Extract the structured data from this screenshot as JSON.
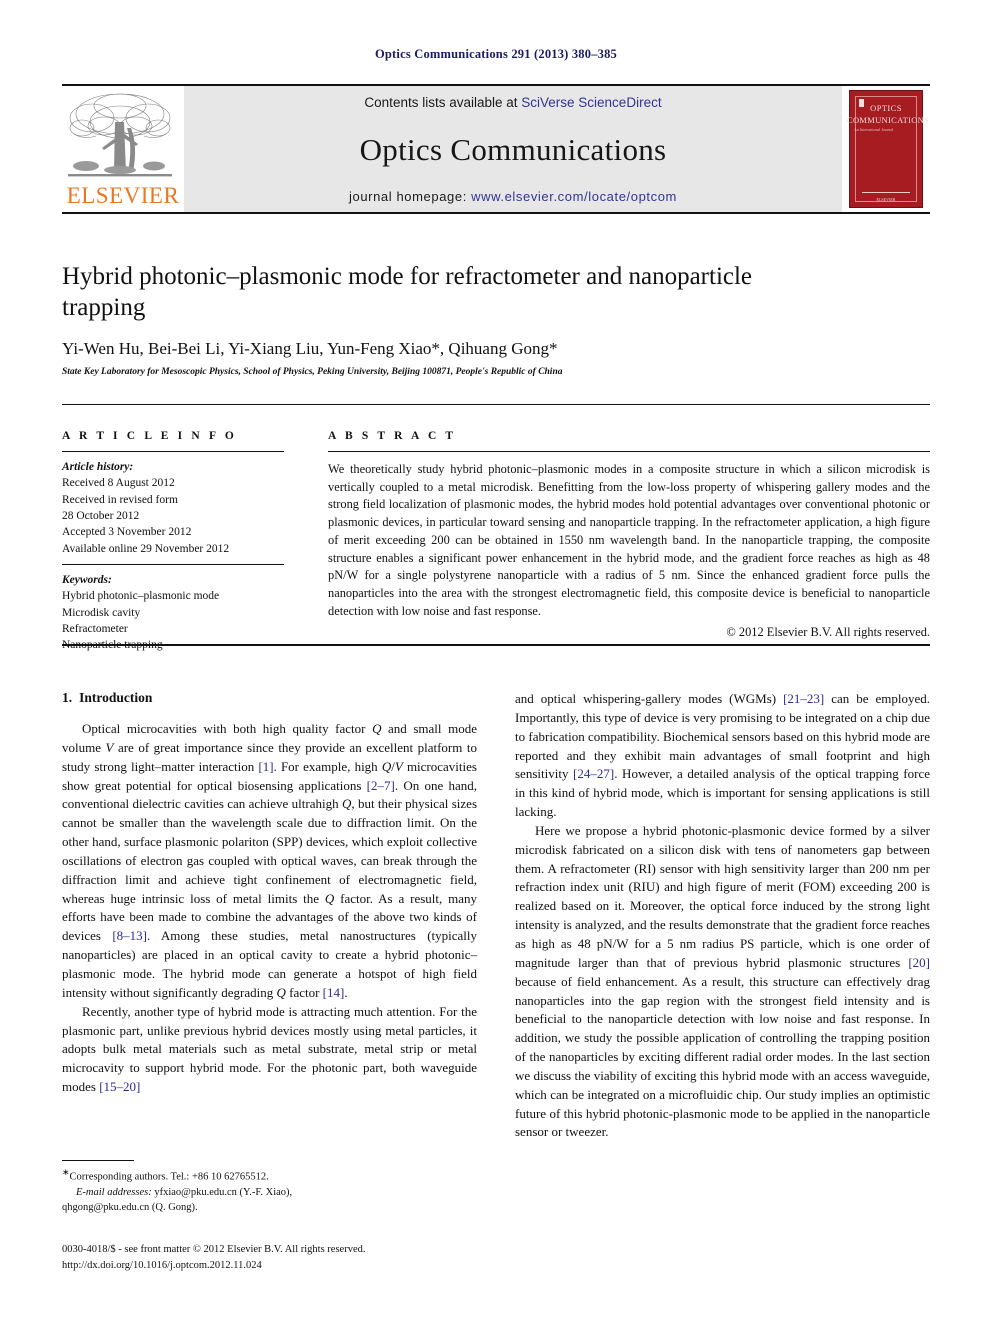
{
  "running_head": "Optics Communications 291 (2013) 380–385",
  "masthead": {
    "publisher_name": "ELSEVIER",
    "contents_prefix": "Contents lists available at ",
    "contents_link": "SciVerse ScienceDirect",
    "journal_title": "Optics Communications",
    "homepage_prefix": "journal homepage: ",
    "homepage_link": "www.elsevier.com/locate/optcom",
    "cover": {
      "line1": "OPTICS",
      "line2": "COMMUNICATIONS",
      "line3": "An International Journal",
      "footer": "ELSEVIER"
    }
  },
  "article": {
    "title": "Hybrid photonic–plasmonic mode for refractometer and nanoparticle trapping",
    "authors": "Yi-Wen Hu, Bei-Bei Li, Yi-Xiang Liu, Yun-Feng Xiao*, Qihuang Gong*",
    "affiliation": "State Key Laboratory for Mesoscopic Physics, School of Physics, Peking University, Beijing 100871, People's Republic of China"
  },
  "article_info": {
    "heading": "A R T I C L E  I N F O",
    "history_label": "Article history:",
    "history": [
      "Received 8 August 2012",
      "Received in revised form",
      "28 October 2012",
      "Accepted 3 November 2012",
      "Available online 29 November 2012"
    ],
    "keywords_label": "Keywords:",
    "keywords": [
      "Hybrid photonic–plasmonic mode",
      "Microdisk cavity",
      "Refractometer",
      "Nanoparticle trapping"
    ]
  },
  "abstract": {
    "heading": "A B S T R A C T",
    "text": "We theoretically study hybrid photonic–plasmonic modes in a composite structure in which a silicon microdisk is vertically coupled to a metal microdisk. Benefitting from the low-loss property of whispering gallery modes and the strong field localization of plasmonic modes, the hybrid modes hold potential advantages over conventional photonic or plasmonic devices, in particular toward sensing and nanoparticle trapping. In the refractometer application, a high figure of merit exceeding 200 can be obtained in 1550 nm wavelength band. In the nanoparticle trapping, the composite structure enables a significant power enhancement in the hybrid mode, and the gradient force reaches as high as 48 pN/W for a single polystyrene nanoparticle with a radius of 5 nm. Since the enhanced gradient force pulls the nanoparticles into the area with the strongest electromagnetic field, this composite device is beneficial to nanoparticle detection with low noise and fast response.",
    "copyright": "© 2012 Elsevier B.V. All rights reserved."
  },
  "section": {
    "number": "1.",
    "heading": "Introduction"
  },
  "body": {
    "left": [
      "Optical microcavities with both high quality factor Q and small mode volume V are of great importance since they provide an excellent platform to study strong light–matter interaction [1]. For example, high Q/V microcavities show great potential for optical biosensing applications [2–7]. On one hand, conventional dielectric cavities can achieve ultrahigh Q, but their physical sizes cannot be smaller than the wavelength scale due to diffraction limit. On the other hand, surface plasmonic polariton (SPP) devices, which exploit collective oscillations of electron gas coupled with optical waves, can break through the diffraction limit and achieve tight confinement of electromagnetic field, whereas huge intrinsic loss of metal limits the Q factor. As a result, many efforts have been made to combine the advantages of the above two kinds of devices [8–13]. Among these studies, metal nanostructures (typically nanoparticles) are placed in an optical cavity to create a hybrid photonic–plasmonic mode. The hybrid mode can generate a hotspot of high field intensity without significantly degrading Q factor [14].",
      "Recently, another type of hybrid mode is attracting much attention. For the plasmonic part, unlike previous hybrid devices mostly using metal particles, it adopts bulk metal materials such as metal substrate, metal strip or metal microcavity to support hybrid mode. For the photonic part, both waveguide modes [15–20]"
    ],
    "right": [
      "and optical whispering-gallery modes (WGMs) [21–23] can be employed. Importantly, this type of device is very promising to be integrated on a chip due to fabrication compatibility. Biochemical sensors based on this hybrid mode are reported and they exhibit main advantages of small footprint and high sensitivity [24–27]. However, a detailed analysis of the optical trapping force in this kind of hybrid mode, which is important for sensing applications is still lacking.",
      "Here we propose a hybrid photonic-plasmonic device formed by a silver microdisk fabricated on a silicon disk with tens of nanometers gap between them. A refractometer (RI) sensor with high sensitivity larger than 200 nm per refraction index unit (RIU) and high figure of merit (FOM) exceeding 200 is realized based on it. Moreover, the optical force induced by the strong light intensity is analyzed, and the results demonstrate that the gradient force reaches as high as 48 pN/W for a 5 nm radius PS particle, which is one order of magnitude larger than that of previous hybrid plasmonic structures [20] because of field enhancement. As a result, this structure can effectively drag nanoparticles into the gap region with the strongest field intensity and is beneficial to the nanoparticle detection with low noise and fast response. In addition, we study the possible application of controlling the trapping position of the nanoparticles by exciting different radial order modes. In the last section we discuss the viability of exciting this hybrid mode with an access waveguide, which can be integrated on a microfluidic chip. Our study implies an optimistic future of this hybrid photonic-plasmonic mode to be applied in the nanoparticle sensor or tweezer."
    ]
  },
  "footnotes": {
    "corresponding": "Corresponding authors. Tel.: +86 10 62765512.",
    "email_label": "E-mail addresses:",
    "email_line1": " yfxiao@pku.edu.cn (Y.-F. Xiao),",
    "email_line2": "qhgong@pku.edu.cn (Q. Gong)."
  },
  "imprint": {
    "issn_line": "0030-4018/$ - see front matter © 2012 Elsevier B.V. All rights reserved.",
    "doi_line": "http://dx.doi.org/10.1016/j.optcom.2012.11.024"
  },
  "colors": {
    "link": "#33339a",
    "reference": "#2b2b8f",
    "elsevier_orange": "#E87722",
    "cover_red": "#a61c21",
    "masthead_gray": "#e7e7e7",
    "running_head": "#1a1a66"
  }
}
